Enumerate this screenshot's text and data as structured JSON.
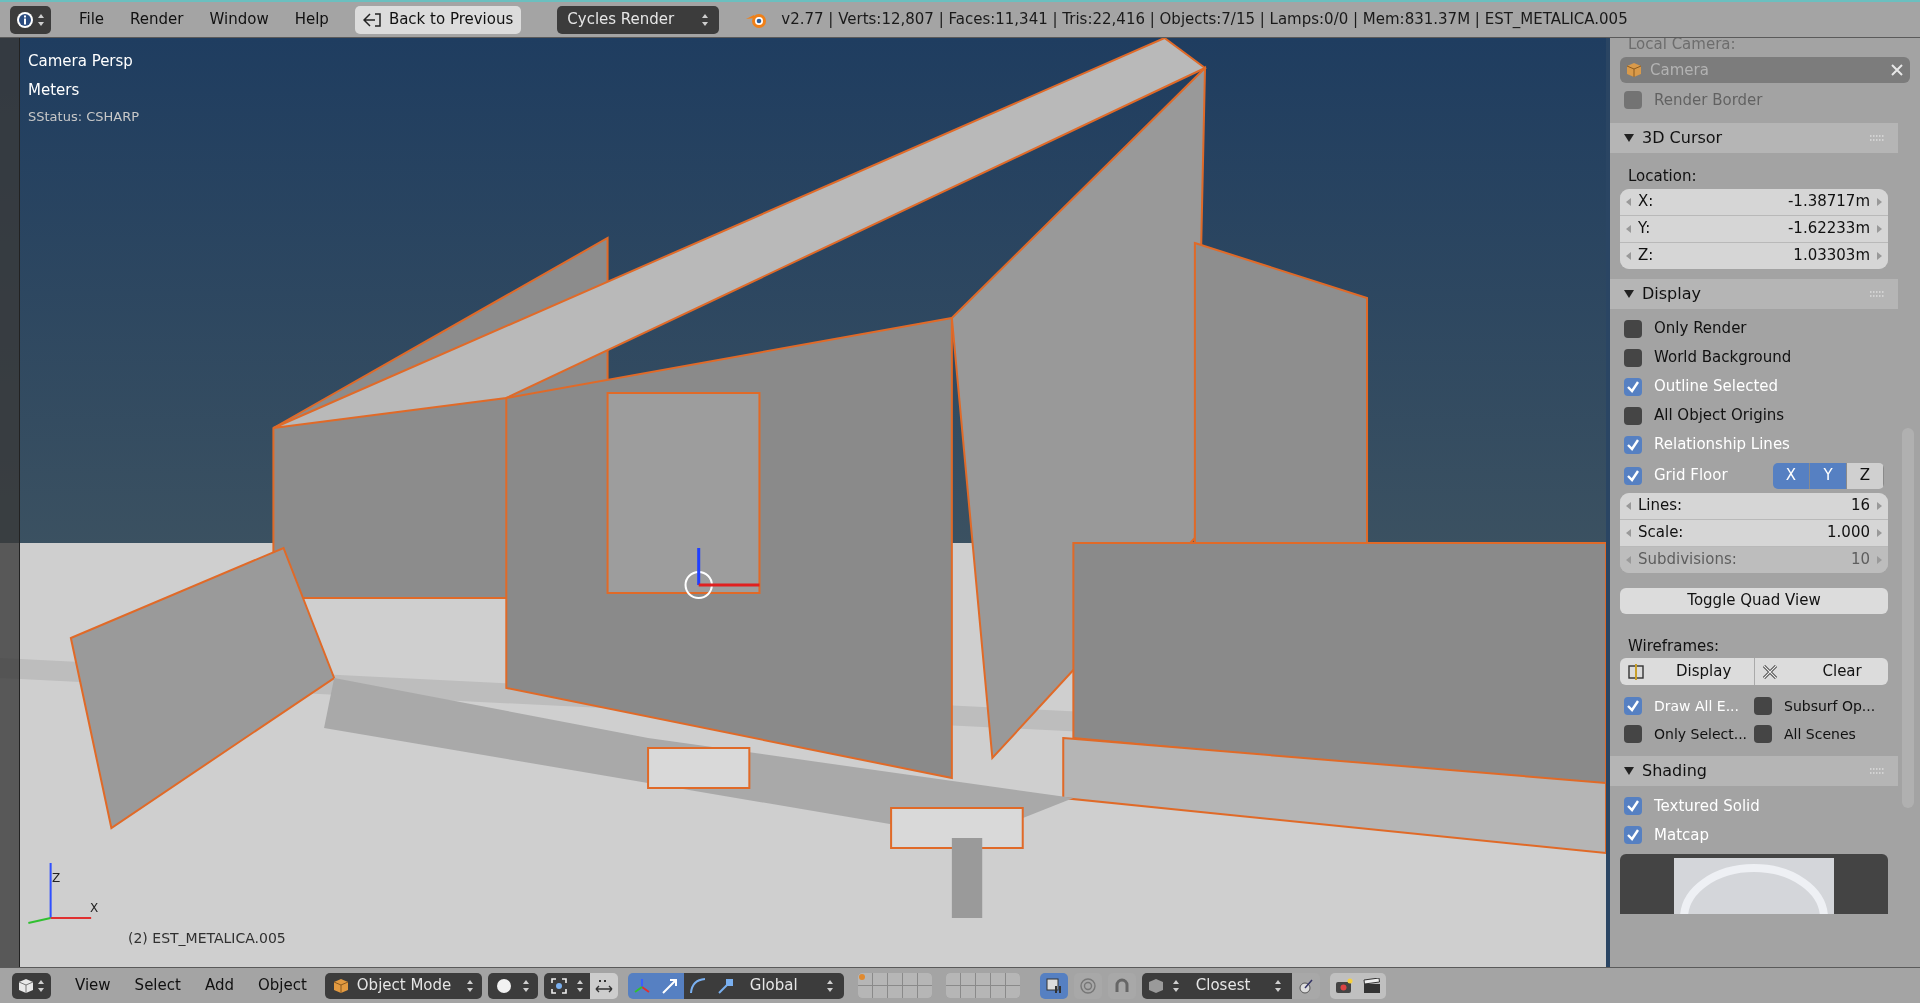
{
  "top_bar": {
    "menus": [
      "File",
      "Render",
      "Window",
      "Help"
    ],
    "back_button": "Back to Previous",
    "engine": "Cycles Render",
    "stats": "v2.77 | Verts:12,807 | Faces:11,341 | Tris:22,416 | Objects:7/15 | Lamps:0/0 | Mem:831.37M | EST_METALICA.005"
  },
  "viewport": {
    "view_name": "Camera Persp",
    "units": "Meters",
    "status": "SStatus: CSHARP",
    "object_label": "(2) EST_METALICA.005",
    "axis_labels": [
      "Z",
      "X"
    ]
  },
  "properties_panel": {
    "local_camera_label": "Local Camera:",
    "camera_field": "Camera",
    "render_border": {
      "label": "Render Border",
      "checked": false
    },
    "sections": [
      {
        "title": "3D Cursor",
        "expanded": true,
        "rows": [
          {
            "kind": "label",
            "text": "Location:"
          },
          {
            "kind": "fields",
            "fields": [
              {
                "label": "X:",
                "value": "-1.38717m",
                "disabled": false
              },
              {
                "label": "Y:",
                "value": "-1.62233m",
                "disabled": false
              },
              {
                "label": "Z:",
                "value": "1.03303m",
                "disabled": false
              }
            ]
          }
        ]
      },
      {
        "title": "Display",
        "expanded": true,
        "rows": [
          {
            "kind": "checkbox",
            "label": "Only Render",
            "checked": false
          },
          {
            "kind": "checkbox",
            "label": "World Background",
            "checked": false
          },
          {
            "kind": "checkbox",
            "label": "Outline Selected",
            "checked": true
          },
          {
            "kind": "checkbox",
            "label": "All Object Origins",
            "checked": false
          },
          {
            "kind": "checkbox",
            "label": "Relationship Lines",
            "checked": true
          },
          {
            "kind": "gridfloor",
            "label": "Grid Floor",
            "checked": true,
            "axes": [
              {
                "label": "X",
                "selected": true
              },
              {
                "label": "Y",
                "selected": true
              },
              {
                "label": "Z",
                "selected": false
              }
            ]
          },
          {
            "kind": "fields",
            "fields": [
              {
                "label": "Lines:",
                "value": "16",
                "disabled": false
              },
              {
                "label": "Scale:",
                "value": "1.000",
                "disabled": false
              },
              {
                "label": "Subdivisions:",
                "value": "10",
                "disabled": true
              }
            ]
          },
          {
            "kind": "button",
            "label": "Toggle Quad View"
          },
          {
            "kind": "label",
            "text": "Wireframes:"
          },
          {
            "kind": "buttonpair",
            "buttons": [
              "Display",
              "Clear"
            ]
          },
          {
            "kind": "checkgrid",
            "items": [
              {
                "label": "Draw All E...",
                "checked": true
              },
              {
                "label": "Subsurf Op...",
                "checked": false
              },
              {
                "label": "Only Select...",
                "checked": false
              },
              {
                "label": "All Scenes",
                "checked": false
              }
            ]
          }
        ]
      },
      {
        "title": "Shading",
        "expanded": true,
        "rows": [
          {
            "kind": "checkbox",
            "label": "Textured Solid",
            "checked": true
          },
          {
            "kind": "checkbox",
            "label": "Matcap",
            "checked": true
          },
          {
            "kind": "matcap"
          }
        ]
      }
    ]
  },
  "bottom_bar": {
    "menus": [
      "View",
      "Select",
      "Add",
      "Object"
    ],
    "mode": "Object Mode",
    "orientation": "Global",
    "snap_target": "Closest",
    "manipulators": [
      {
        "kind": "axes",
        "selected": true
      },
      {
        "kind": "translate",
        "selected": true
      },
      {
        "kind": "rotate",
        "selected": false
      },
      {
        "kind": "scale",
        "selected": false
      }
    ],
    "layers": [
      {
        "occupied": true
      },
      {
        "occupied": false
      },
      {
        "occupied": false
      },
      {
        "occupied": false
      },
      {
        "occupied": false
      },
      {
        "occupied": false
      },
      {
        "occupied": false
      },
      {
        "occupied": false
      },
      {
        "occupied": false
      },
      {
        "occupied": false
      },
      {
        "occupied": false
      },
      {
        "occupied": false
      },
      {
        "occupied": false
      },
      {
        "occupied": false
      },
      {
        "occupied": false
      },
      {
        "occupied": false
      },
      {
        "occupied": false
      },
      {
        "occupied": false
      },
      {
        "occupied": false
      },
      {
        "occupied": false
      }
    ],
    "lock_camera": {
      "selected": true
    }
  }
}
